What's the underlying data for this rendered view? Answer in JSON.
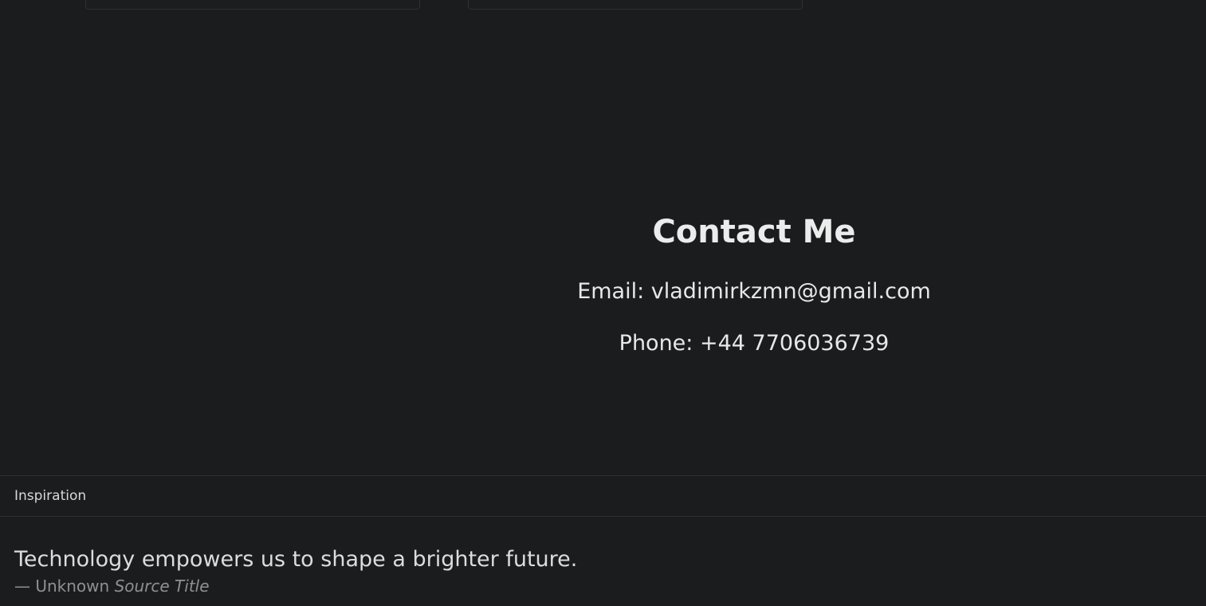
{
  "contact": {
    "title": "Contact Me",
    "email_line": "Email: vladimirkzmn@gmail.com",
    "phone_line": "Phone: +44 7706036739"
  },
  "footer": {
    "header": "Inspiration",
    "quote": "Technology empowers us to shape a brighter future.",
    "author_prefix": "— Unknown",
    "source_title": "Source Title"
  },
  "colors": {
    "background": "#1b1c1e",
    "text": "#e6e6e6",
    "muted": "#8f9093",
    "border": "#2c2e31"
  }
}
